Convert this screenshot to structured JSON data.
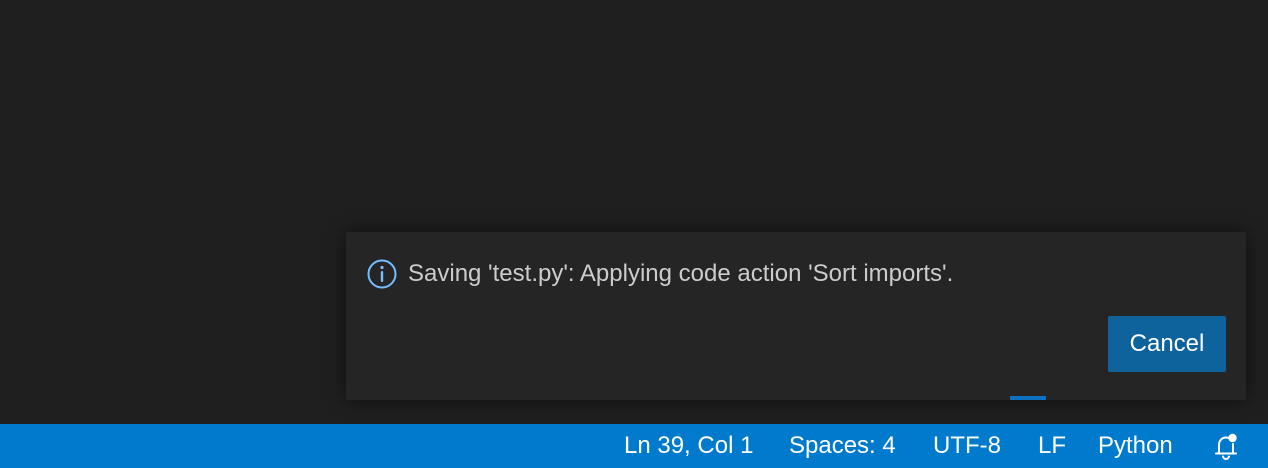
{
  "notification": {
    "icon": "info-icon",
    "message": "Saving 'test.py': Applying code action 'Sort imports'.",
    "cancel_label": "Cancel"
  },
  "status_bar": {
    "cursor_position": "Ln 39, Col 1",
    "indentation": "Spaces: 4",
    "encoding": "UTF-8",
    "line_ending": "LF",
    "language": "Python",
    "notifications_icon": "bell-dot-icon"
  },
  "colors": {
    "editor_background": "#1f1f1f",
    "toast_background": "#252526",
    "info_icon": "#75beff",
    "button_background": "#0e639c",
    "status_bar_background": "#007acc",
    "text": "#cccccc"
  }
}
